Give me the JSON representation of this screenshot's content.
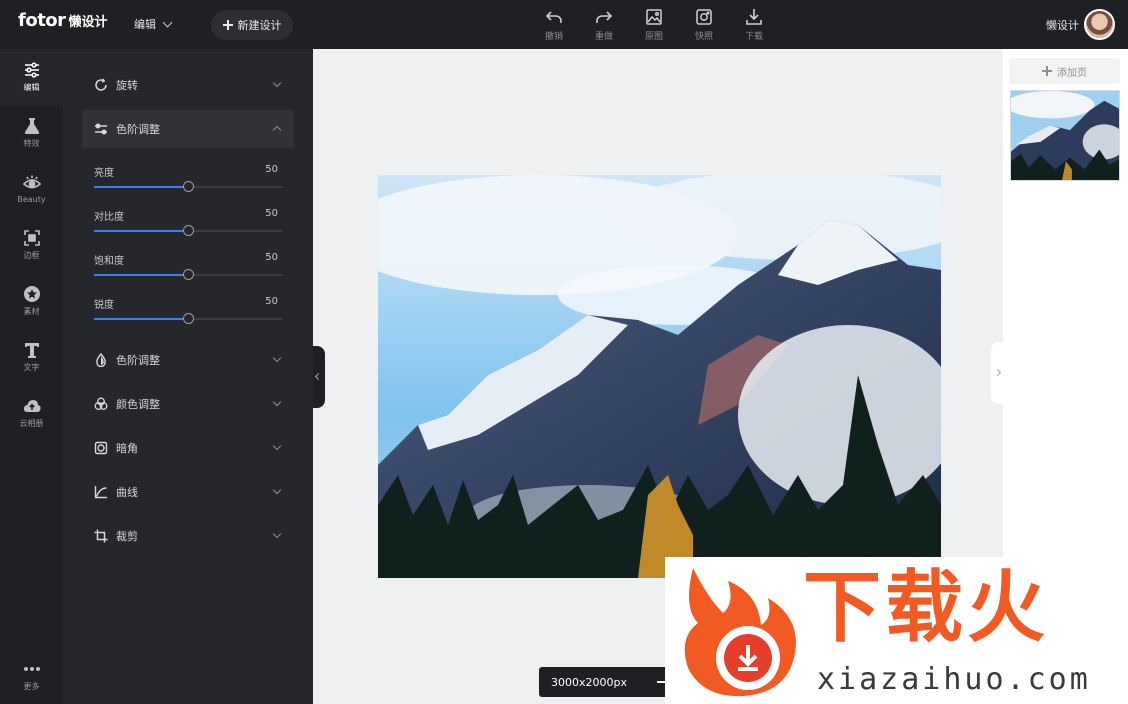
{
  "app": {
    "logo": "fotor",
    "logo_cn": "懒设计",
    "mode": "编辑",
    "new_design": "新建设计",
    "user_name": "懒设计"
  },
  "toolbar": [
    {
      "label": "撤销",
      "icon": "undo-icon"
    },
    {
      "label": "重做",
      "icon": "redo-icon"
    },
    {
      "label": "原图",
      "icon": "original-image-icon"
    },
    {
      "label": "快照",
      "icon": "snapshot-icon"
    },
    {
      "label": "下载",
      "icon": "download-icon"
    }
  ],
  "rail": [
    {
      "label": "编辑",
      "icon": "sliders-icon",
      "active": true
    },
    {
      "label": "特效",
      "icon": "flask-icon"
    },
    {
      "label": "Beauty",
      "icon": "eye-icon"
    },
    {
      "label": "边框",
      "icon": "frame-icon"
    },
    {
      "label": "素材",
      "icon": "star-icon"
    },
    {
      "label": "文字",
      "icon": "text-icon"
    },
    {
      "label": "云相册",
      "icon": "cloud-upload-icon"
    },
    {
      "label": "更多",
      "icon": "more-icon"
    }
  ],
  "panel": {
    "rotate": "旋转",
    "levels_open": "色阶调整",
    "sliders": [
      {
        "label": "亮度",
        "value": 50
      },
      {
        "label": "对比度",
        "value": 50
      },
      {
        "label": "饱和度",
        "value": 50
      },
      {
        "label": "锐度",
        "value": 50
      }
    ],
    "sections": [
      {
        "label": "色阶调整",
        "icon": "drop-icon"
      },
      {
        "label": "颜色调整",
        "icon": "color-circles-icon"
      },
      {
        "label": "暗角",
        "icon": "vignette-icon"
      },
      {
        "label": "曲线",
        "icon": "curve-icon"
      },
      {
        "label": "裁剪",
        "icon": "crop-icon"
      }
    ]
  },
  "canvas": {
    "size_label": "3000x2000px"
  },
  "pages": {
    "add_page": "添加页"
  },
  "watermark": {
    "cn": "下载火",
    "en": "xiazaihuo.com"
  },
  "colors": {
    "accent": "#3b7cf6",
    "dark": "#1f2023",
    "panel": "#26272b",
    "watermark_orange": "#f15a22"
  }
}
